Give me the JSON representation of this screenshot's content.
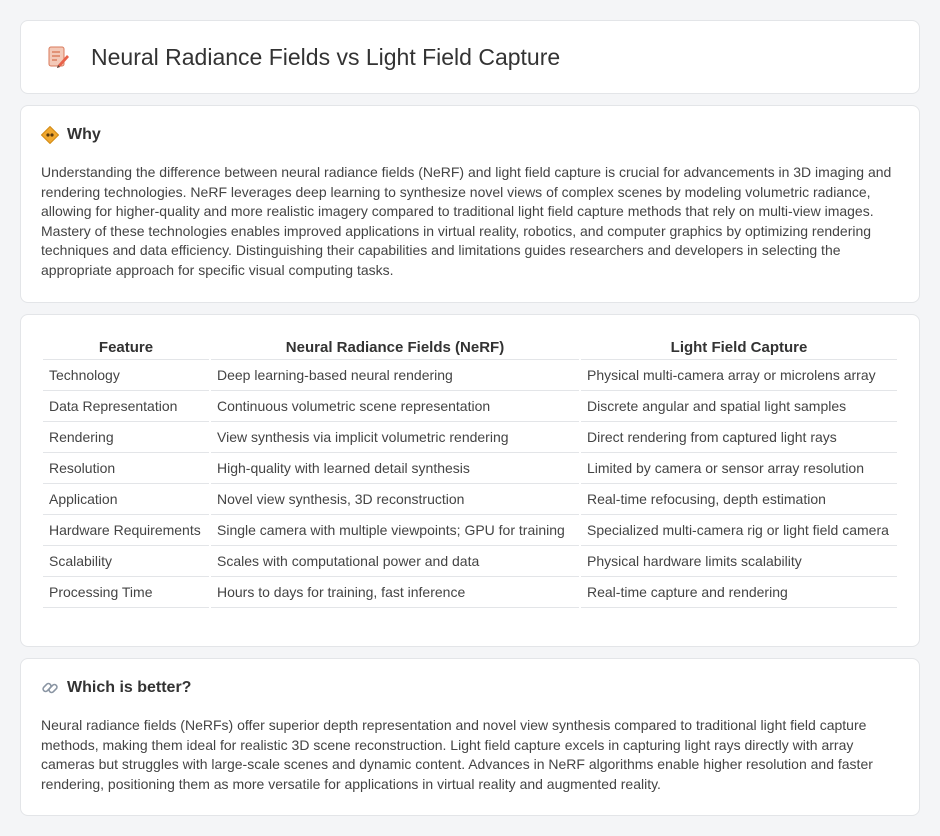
{
  "header": {
    "title": "Neural Radiance Fields vs Light Field Capture",
    "icon": "document-pencil-icon"
  },
  "why": {
    "title": "Why",
    "icon": "diamond-sign-icon",
    "text": "Understanding the difference between neural radiance fields (NeRF) and light field capture is crucial for advancements in 3D imaging and rendering technologies. NeRF leverages deep learning to synthesize novel views of complex scenes by modeling volumetric radiance, allowing for higher-quality and more realistic imagery compared to traditional light field capture methods that rely on multi-view images. Mastery of these technologies enables improved applications in virtual reality, robotics, and computer graphics by optimizing rendering techniques and data efficiency. Distinguishing their capabilities and limitations guides researchers and developers in selecting the appropriate approach for specific visual computing tasks."
  },
  "table": {
    "headers": [
      "Feature",
      "Neural Radiance Fields (NeRF)",
      "Light Field Capture"
    ],
    "rows": [
      [
        "Technology",
        "Deep learning-based neural rendering",
        "Physical multi-camera array or microlens array"
      ],
      [
        "Data Representation",
        "Continuous volumetric scene representation",
        "Discrete angular and spatial light samples"
      ],
      [
        "Rendering",
        "View synthesis via implicit volumetric rendering",
        "Direct rendering from captured light rays"
      ],
      [
        "Resolution",
        "High-quality with learned detail synthesis",
        "Limited by camera or sensor array resolution"
      ],
      [
        "Application",
        "Novel view synthesis, 3D reconstruction",
        "Real-time refocusing, depth estimation"
      ],
      [
        "Hardware Requirements",
        "Single camera with multiple viewpoints; GPU for training",
        "Specialized multi-camera rig or light field camera"
      ],
      [
        "Scalability",
        "Scales with computational power and data",
        "Physical hardware limits scalability"
      ],
      [
        "Processing Time",
        "Hours to days for training, fast inference",
        "Real-time capture and rendering"
      ]
    ]
  },
  "better": {
    "title": "Which is better?",
    "icon": "link-icon",
    "text": "Neural radiance fields (NeRFs) offer superior depth representation and novel view synthesis compared to traditional light field capture methods, making them ideal for realistic 3D scene reconstruction. Light field capture excels in capturing light rays directly with array cameras but struggles with large-scale scenes and dynamic content. Advances in NeRF algorithms enable higher resolution and faster rendering, positioning them as more versatile for applications in virtual reality and augmented reality."
  }
}
